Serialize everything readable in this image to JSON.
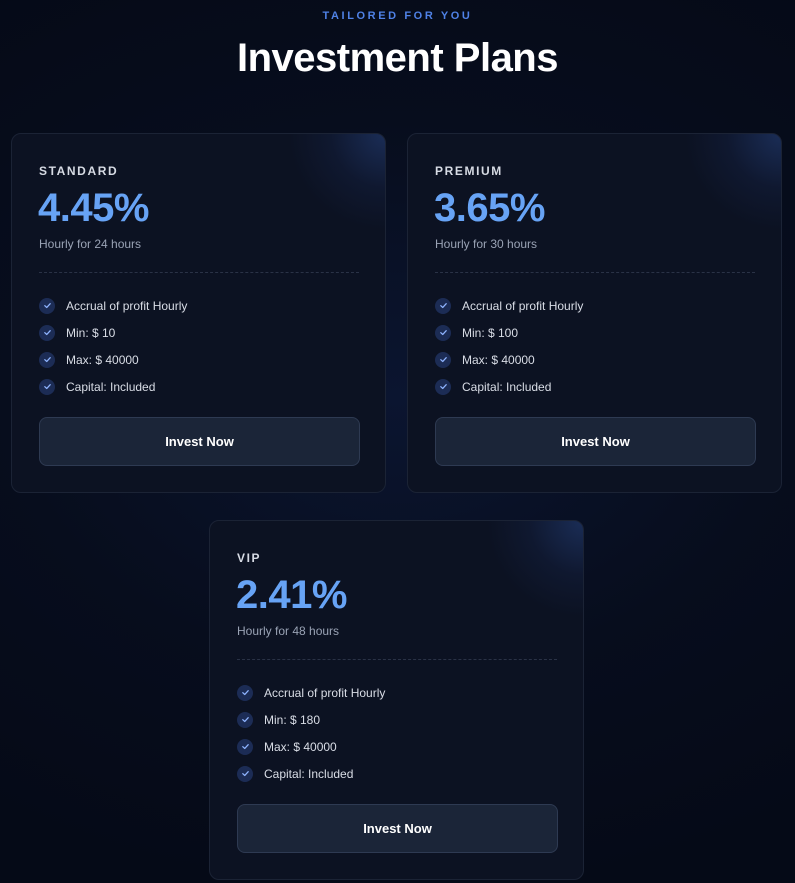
{
  "header": {
    "eyebrow": "TAILORED FOR YOU",
    "title": "Investment Plans"
  },
  "colors": {
    "accent": "#67a3f5",
    "eyebrow": "#4f82e6",
    "background": "#070d1d",
    "card": "#0c1222",
    "check_bg": "#1c2c55"
  },
  "plans": [
    {
      "name": "STANDARD",
      "rate": "4.45%",
      "period": "Hourly for 24 hours",
      "features": [
        {
          "icon": "check-icon",
          "text": "Accrual of profit Hourly"
        },
        {
          "icon": "check-icon",
          "text": "Min: $ 10"
        },
        {
          "icon": "check-icon",
          "text": "Max: $ 40000"
        },
        {
          "icon": "check-icon",
          "text": "Capital: Included"
        }
      ],
      "button_label": "Invest Now"
    },
    {
      "name": "PREMIUM",
      "rate": "3.65%",
      "period": "Hourly for 30 hours",
      "features": [
        {
          "icon": "check-icon",
          "text": "Accrual of profit Hourly"
        },
        {
          "icon": "check-icon",
          "text": "Min: $ 100"
        },
        {
          "icon": "check-icon",
          "text": "Max: $ 40000"
        },
        {
          "icon": "check-icon",
          "text": "Capital: Included"
        }
      ],
      "button_label": "Invest Now"
    },
    {
      "name": "VIP",
      "rate": "2.41%",
      "period": "Hourly for 48 hours",
      "features": [
        {
          "icon": "check-icon",
          "text": "Accrual of profit Hourly"
        },
        {
          "icon": "check-icon",
          "text": "Min: $ 180"
        },
        {
          "icon": "check-icon",
          "text": "Max: $ 40000"
        },
        {
          "icon": "check-icon",
          "text": "Capital: Included"
        }
      ],
      "button_label": "Invest Now"
    }
  ]
}
